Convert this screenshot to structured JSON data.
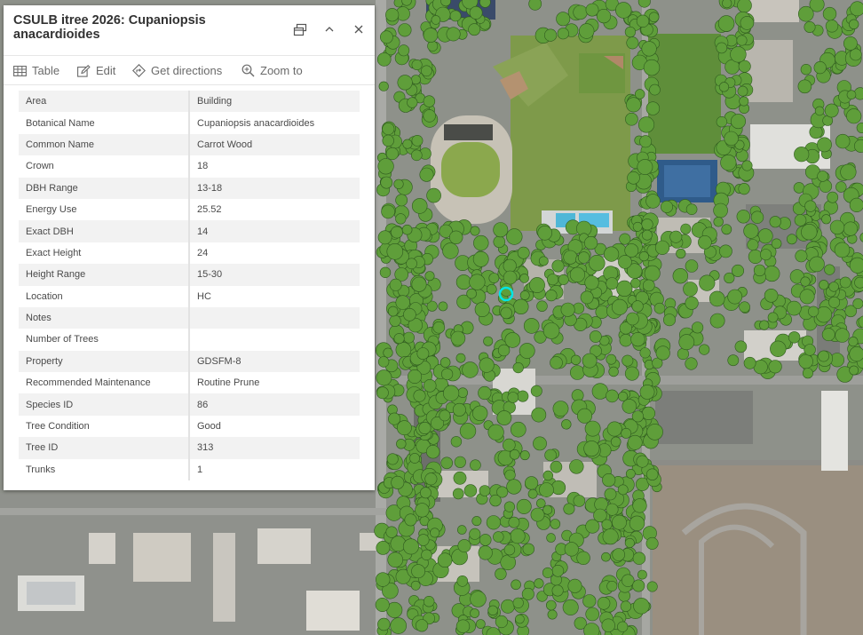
{
  "popup": {
    "title": "CSULB itree 2026: Cupaniopsis anacardioides",
    "icons": {
      "dock": "dock-icon",
      "collapse": "chevron-up-icon",
      "close": "close-icon"
    },
    "actions": [
      {
        "id": "table",
        "label": "Table",
        "icon": "table-icon"
      },
      {
        "id": "edit",
        "label": "Edit",
        "icon": "edit-icon"
      },
      {
        "id": "directions",
        "label": "Get directions",
        "icon": "directions-icon"
      },
      {
        "id": "zoom",
        "label": "Zoom to",
        "icon": "zoom-to-icon"
      }
    ],
    "attributes": [
      {
        "field": "Area",
        "value": "Building"
      },
      {
        "field": "Botanical Name",
        "value": "Cupaniopsis anacardioides"
      },
      {
        "field": "Common Name",
        "value": "Carrot Wood"
      },
      {
        "field": "Crown",
        "value": "18"
      },
      {
        "field": "DBH Range",
        "value": "13-18"
      },
      {
        "field": "Energy Use",
        "value": "25.52"
      },
      {
        "field": "Exact DBH",
        "value": "14"
      },
      {
        "field": "Exact Height",
        "value": "24"
      },
      {
        "field": "Height Range",
        "value": "15-30"
      },
      {
        "field": "Location",
        "value": "HC"
      },
      {
        "field": "Notes",
        "value": ""
      },
      {
        "field": "Number of Trees",
        "value": ""
      },
      {
        "field": "Property",
        "value": "GDSFM-8"
      },
      {
        "field": "Recommended Maintenance",
        "value": "Routine Prune"
      },
      {
        "field": "Species ID",
        "value": "86"
      },
      {
        "field": "Tree Condition",
        "value": "Good"
      },
      {
        "field": "Tree ID",
        "value": "313"
      },
      {
        "field": "Trunks",
        "value": "1"
      }
    ]
  },
  "map": {
    "tree_color": "#5f9e3a",
    "tree_outline": "#2f5a1f",
    "selection_color": "#00e5e5"
  }
}
